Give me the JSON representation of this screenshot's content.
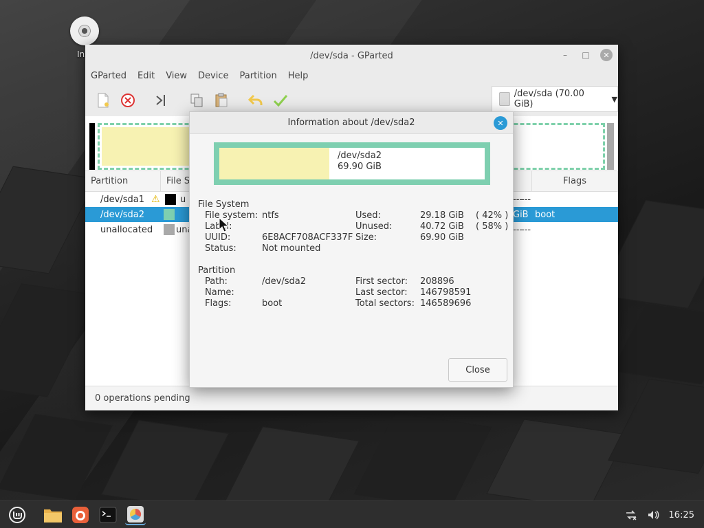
{
  "desktop": {
    "icon_label": "Inst"
  },
  "window": {
    "title": "/dev/sda - GParted",
    "menu": [
      "GParted",
      "Edit",
      "View",
      "Device",
      "Partition",
      "Help"
    ],
    "device_selector": "/dev/sda (70.00 GiB)",
    "columns": {
      "partition": "Partition",
      "filesystem": "File S",
      "flags": "Flags"
    },
    "rows": [
      {
        "name": "/dev/sda1",
        "fs_fragment": "u",
        "tail1": "---",
        "tail2": "---",
        "flags": ""
      },
      {
        "name": "/dev/sda2",
        "fs_fragment": "",
        "tail1": "GiB",
        "tail2": "",
        "flags": "boot"
      },
      {
        "name": "unallocated",
        "fs_fragment": "una",
        "tail1": "---",
        "tail2": "---",
        "flags": ""
      }
    ],
    "status": "0 operations pending"
  },
  "dialog": {
    "title": "Information about /dev/sda2",
    "graphic": {
      "name": "/dev/sda2",
      "size": "69.90 GiB"
    },
    "filesystem_section": {
      "heading": "File System",
      "file_system_label": "File system:",
      "file_system_value": "ntfs",
      "label_label": "Label:",
      "label_value": "",
      "uuid_label": "UUID:",
      "uuid_value": "6E8ACF708ACF337F",
      "status_label": "Status:",
      "status_value": "Not mounted",
      "used_label": "Used:",
      "used_value": "29.18 GiB",
      "used_pct": "( 42% )",
      "unused_label": "Unused:",
      "unused_value": "40.72 GiB",
      "unused_pct": "( 58% )",
      "size_label": "Size:",
      "size_value": "69.90 GiB"
    },
    "partition_section": {
      "heading": "Partition",
      "path_label": "Path:",
      "path_value": "/dev/sda2",
      "name_label": "Name:",
      "name_value": "",
      "flags_label": "Flags:",
      "flags_value": "boot",
      "first_sector_label": "First sector:",
      "first_sector_value": "208896",
      "last_sector_label": "Last sector:",
      "last_sector_value": "146798591",
      "total_sectors_label": "Total sectors:",
      "total_sectors_value": "146589696"
    },
    "close_label": "Close"
  },
  "taskbar": {
    "clock": "16:25"
  },
  "colors": {
    "accent": "#2a9ad6",
    "ntfs": "#7ecfb0",
    "used_fill": "#f7f2b2",
    "unallocated": "#a9a9a9"
  }
}
